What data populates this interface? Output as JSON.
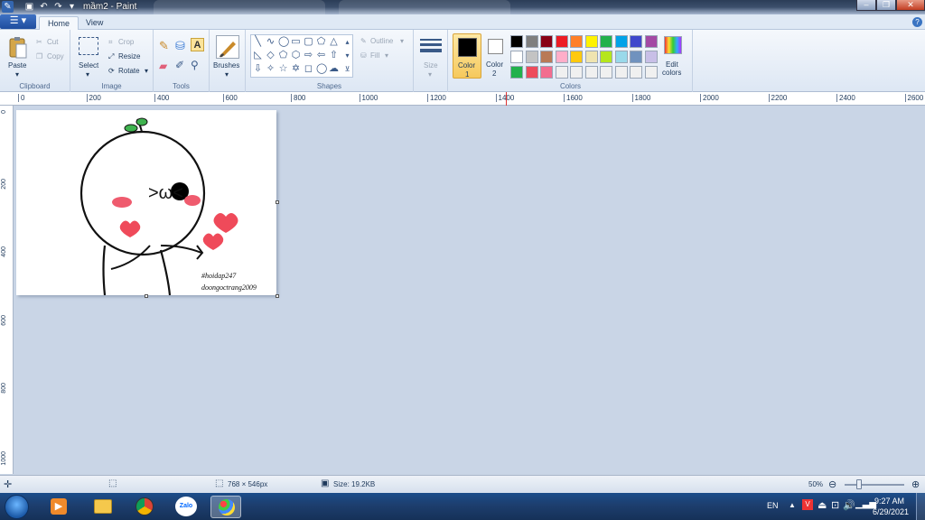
{
  "titlebar": {
    "title": "mầm2 - Paint",
    "quick_access": [
      "save-icon",
      "undo-icon",
      "redo-icon",
      "dropdown-icon"
    ],
    "window_buttons": [
      "minimize",
      "restore",
      "close"
    ]
  },
  "tabs": {
    "file_label": "",
    "home": "Home",
    "view": "View",
    "help": "?"
  },
  "ribbon": {
    "clipboard": {
      "label": "Clipboard",
      "paste": "Paste",
      "cut": "Cut",
      "copy": "Copy"
    },
    "image": {
      "label": "Image",
      "select": "Select",
      "crop": "Crop",
      "resize": "Resize",
      "rotate": "Rotate"
    },
    "tools": {
      "label": "Tools"
    },
    "brushes": {
      "label": "Brushes"
    },
    "shapes": {
      "label": "Shapes",
      "outline": "Outline",
      "fill": "Fill"
    },
    "size": {
      "label": "Size"
    },
    "color1": {
      "label": "Color",
      "num": "1",
      "value": "#000000"
    },
    "color2": {
      "label": "Color",
      "num": "2",
      "value": "#ffffff"
    },
    "colors": {
      "label": "Colors",
      "edit": "Edit",
      "edit2": "colors",
      "palette_row1": [
        "#000000",
        "#7f7f7f",
        "#880015",
        "#ed1c24",
        "#ff7f27",
        "#fff200",
        "#22b14c",
        "#00a2e8",
        "#3f48cc",
        "#a349a4"
      ],
      "palette_row2": [
        "#ffffff",
        "#c3c3c3",
        "#b97a57",
        "#ffaec9",
        "#ffc90e",
        "#efe4b0",
        "#b5e61d",
        "#99d9ea",
        "#7092be",
        "#c8bfe7"
      ],
      "palette_row3": [
        "#22b14c",
        "#ed4b5c",
        "#f26d8f",
        "#f0f0f0",
        "#f0f0f0",
        "#f0f0f0",
        "#f0f0f0",
        "#f0f0f0",
        "#f0f0f0",
        "#f0f0f0"
      ]
    }
  },
  "ruler": {
    "h_ticks": [
      "0",
      "200",
      "400",
      "600",
      "800",
      "1000",
      "1200",
      "1400",
      "1600",
      "1800",
      "2000",
      "2200",
      "2400",
      "2600"
    ],
    "v_ticks": [
      "0",
      "200",
      "400",
      "600",
      "800",
      "1000"
    ]
  },
  "drawing": {
    "text1": "#hoidap247",
    "text2": "doongoctrang2009",
    "face": ">ω<"
  },
  "status": {
    "dimensions": "768 × 546px",
    "size": "Size: 19.2KB",
    "zoom": "50%"
  },
  "taskbar": {
    "lang": "EN",
    "time": "9:27 AM",
    "date": "6/29/2021",
    "apps": [
      "start-orb",
      "media-player",
      "file-explorer",
      "chrome",
      "zalo",
      "paint"
    ]
  }
}
